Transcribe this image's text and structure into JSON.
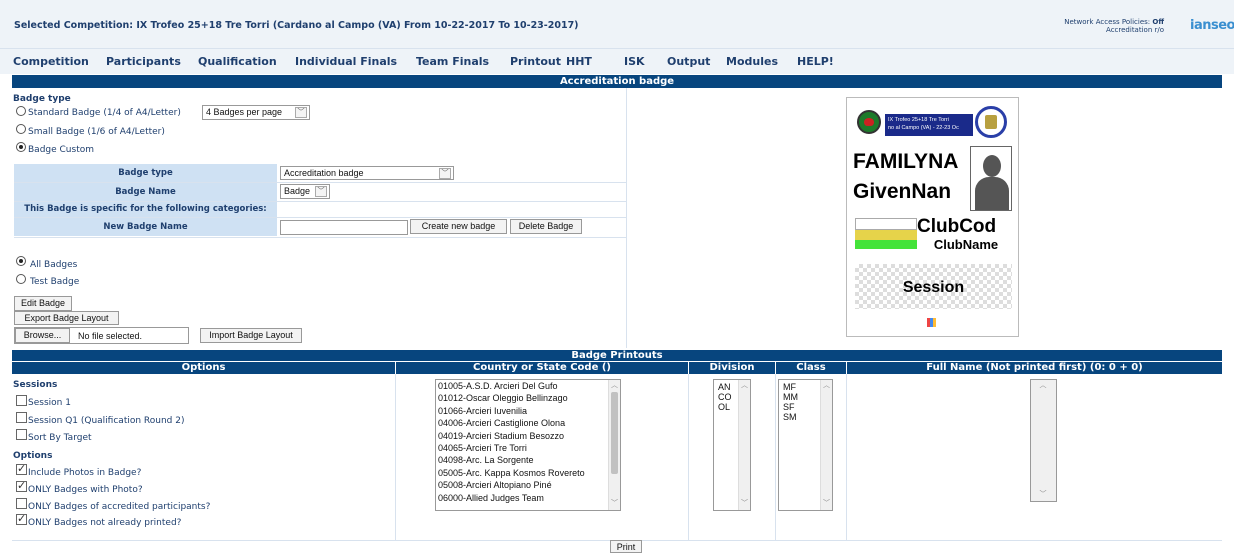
{
  "header": {
    "title": "Selected Competition: IX Trofeo 25+18 Tre Torri (Cardano al Campo (VA) From 10-22-2017 To 10-23-2017)",
    "network_label": "Network Access Policies:",
    "network_value": "Off",
    "accreditation": "Accreditation r/o",
    "logo_text": "ianseo"
  },
  "menu": [
    "Competition",
    "Participants",
    "Qualification",
    "Individual Finals",
    "Team Finals",
    "Printout",
    "HHT",
    "ISK",
    "Output",
    "Modules",
    "HELP!"
  ],
  "section_title": "Accreditation badge",
  "badge_type_title": "Badge type",
  "badge_options": [
    {
      "label": "Standard Badge (1/4 of A4/Letter)",
      "selected": false
    },
    {
      "label": "Small Badge (1/6 of A4/Letter)",
      "selected": false
    },
    {
      "label": "Badge Custom",
      "selected": true
    }
  ],
  "per_page_select": "4 Badges per page",
  "form": {
    "badge_type_label": "Badge type",
    "badge_type_value": "Accreditation badge",
    "badge_name_label": "Badge Name",
    "badge_name_value": "Badge",
    "categories_label": "This Badge is specific for the following categories:",
    "new_badge_label": "New Badge Name",
    "new_badge_value": "",
    "create_button": "Create new badge",
    "delete_button": "Delete Badge"
  },
  "scope_options": [
    {
      "label": "All Badges",
      "selected": true
    },
    {
      "label": "Test Badge",
      "selected": false
    }
  ],
  "buttons": {
    "edit": "Edit Badge",
    "export": "Export Badge Layout",
    "browse": "Browse...",
    "file_status": "No file selected.",
    "import": "Import Badge Layout",
    "print": "Print"
  },
  "preview": {
    "event_line1": "IX Trofeo 25+18 Tre Torri",
    "event_line2": "no al Campo (VA) - 22-23 Oc",
    "family_name": "FAMILYNA",
    "given_name": "GivenNan",
    "club_code": "ClubCod",
    "club_name": "ClubName",
    "session": "Session"
  },
  "printouts": {
    "title": "Badge Printouts",
    "columns": [
      "Options",
      "Country or State Code ()",
      "Division",
      "Class",
      "Full Name (Not printed first) (0: 0 + 0)"
    ],
    "sessions_title": "Sessions",
    "sessions": [
      {
        "label": "Session 1",
        "checked": false
      },
      {
        "label": "Session Q1 (Qualification Round 2)",
        "checked": false
      },
      {
        "label": "Sort By Target",
        "checked": false
      }
    ],
    "options_title": "Options",
    "options": [
      {
        "label": "Include Photos in Badge?",
        "checked": true
      },
      {
        "label": "ONLY Badges with Photo?",
        "checked": true
      },
      {
        "label": "ONLY Badges of accredited participants?",
        "checked": false
      },
      {
        "label": "ONLY Badges not already printed?",
        "checked": true
      }
    ],
    "countries": [
      "01005-A.S.D. Arcieri Del Gufo",
      "01012-Oscar Oleggio Bellinzago",
      "01066-Arcieri Iuvenilia",
      "04006-Arcieri Castiglione Olona",
      "04019-Arcieri Stadium Besozzo",
      "04065-Arcieri Tre Torri",
      "04098-Arc. La Sorgente",
      "05005-Arc. Kappa Kosmos Rovereto",
      "05008-Arcieri Altopiano Piné",
      "06000-Allied Judges Team"
    ],
    "divisions": [
      "AN",
      "CO",
      "OL"
    ],
    "classes": [
      "MF",
      "MM",
      "SF",
      "SM"
    ]
  }
}
